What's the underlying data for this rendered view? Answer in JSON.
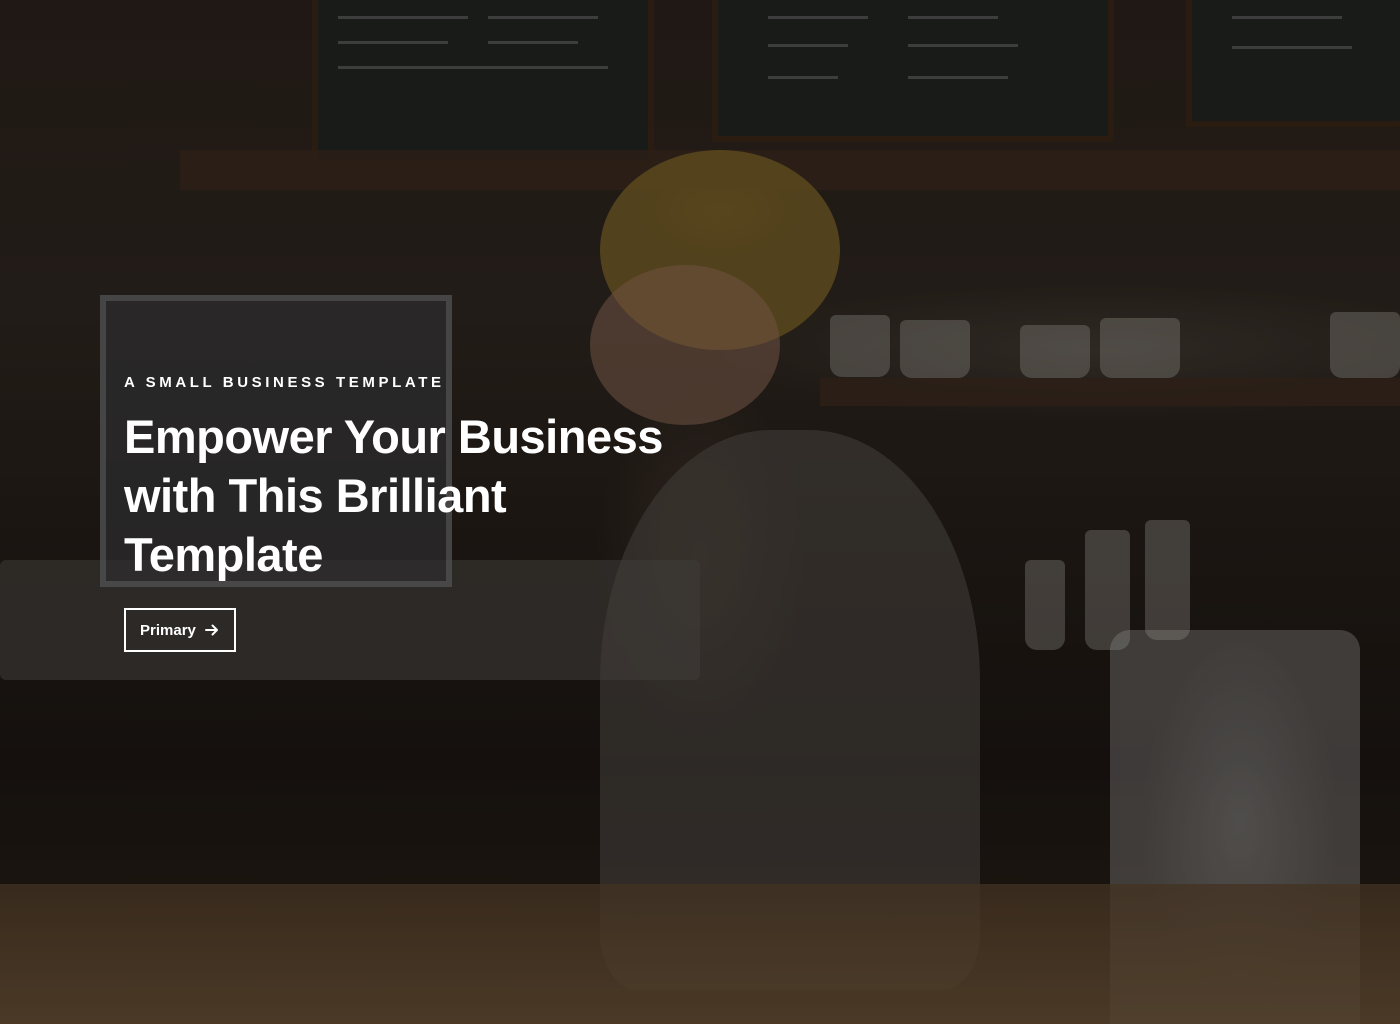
{
  "hero": {
    "eyebrow": "A SMALL BUSINESS TEMPLATE",
    "headline": "Empower Your Business with This Brilliant Template",
    "primary_button": {
      "label": "Primary",
      "icon": "arrow-right-icon"
    }
  },
  "colors": {
    "text": "#ffffff",
    "button_border": "#ffffff"
  }
}
